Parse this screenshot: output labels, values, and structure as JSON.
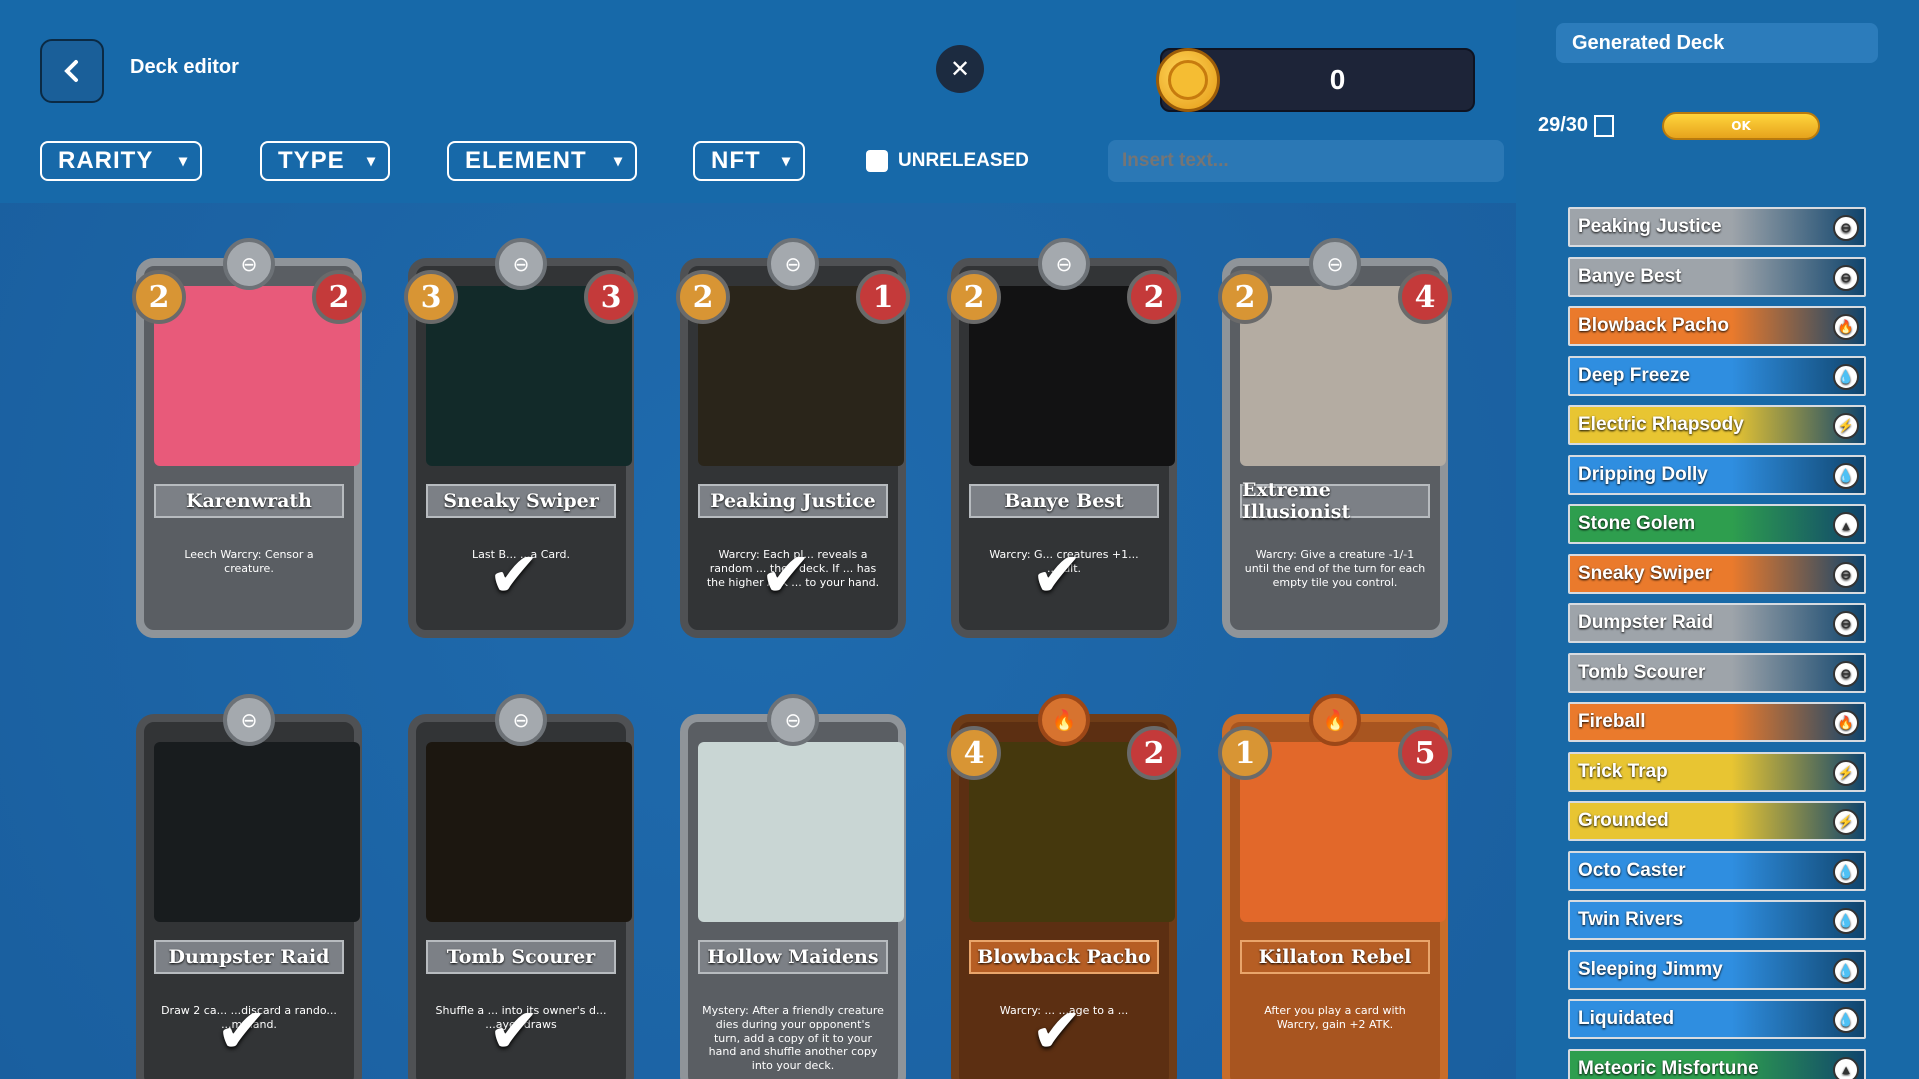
{
  "header": {
    "title": "Deck editor",
    "coins": "0",
    "close_glyph": "✕"
  },
  "filters": [
    {
      "label": "RARITY"
    },
    {
      "label": "TYPE"
    },
    {
      "label": "ELEMENT"
    },
    {
      "label": "NFT"
    }
  ],
  "unreleased_label": "UNRELEASED",
  "search": {
    "placeholder": "Insert text..."
  },
  "cards": [
    {
      "name": "Karenwrath",
      "cost": "2",
      "atk": "2",
      "desc": "Leech\nWarcry: Censor a creature.",
      "selected": false,
      "element": "neutral",
      "art": "#e85a7a"
    },
    {
      "name": "Sneaky Swiper",
      "cost": "3",
      "atk": "3",
      "desc": "Last B... ...a Card.",
      "selected": true,
      "element": "neutral",
      "art": "#3c8a88"
    },
    {
      "name": "Peaking Justice",
      "cost": "2",
      "atk": "1",
      "desc": "Warcry: Each pl... reveals a random ... their deck. If ... has the higher ATK ... to your hand.",
      "selected": true,
      "element": "neutral",
      "art": "#8a7a58"
    },
    {
      "name": "Banye Best",
      "cost": "2",
      "atk": "2",
      "desc": "Warcry: G... creatures +1... ...sult.",
      "selected": true,
      "element": "neutral",
      "art": "#3a3a3f"
    },
    {
      "name": "Extreme Illusionist",
      "cost": "2",
      "atk": "4",
      "desc": "Warcry: Give a creature -1/-1 until the end of the turn for each empty tile you control.",
      "selected": false,
      "element": "neutral",
      "art": "#b4aca2"
    },
    {
      "name": "Dumpster Raid",
      "cost": "",
      "atk": "",
      "desc": "Draw 2 ca... ...discard a rando... ...m hand.",
      "selected": true,
      "element": "neutral",
      "art": "#505a62"
    },
    {
      "name": "Tomb Scourer",
      "cost": "",
      "atk": "",
      "desc": "Shuffle a ... into its owner's d... ...ayer draws",
      "selected": true,
      "element": "neutral",
      "art": "#5a4a36"
    },
    {
      "name": "Hollow Maidens",
      "cost": "",
      "atk": "",
      "desc": "Mystery: After a friendly creature dies during your opponent's turn, add a copy of it to your hand and shuffle another copy into your deck.",
      "selected": false,
      "element": "neutral",
      "art": "#c9d6d4"
    },
    {
      "name": "Blowback Pacho",
      "cost": "4",
      "atk": "2",
      "desc": "Warcry: ... ...age to a ...",
      "selected": true,
      "element": "fire",
      "art": "#e3b72a"
    },
    {
      "name": "Killaton Rebel",
      "cost": "1",
      "atk": "5",
      "desc": "After you play a card with Warcry, gain +2 ATK.",
      "selected": false,
      "element": "fire",
      "art": "#e2682a"
    }
  ],
  "sidebar": {
    "deck_name": "Generated Deck",
    "count": "29/30",
    "ok_label": "OK",
    "deck": [
      {
        "name": "Peaking Justice",
        "color": "#9ea4aa",
        "el": "neutral-icon",
        "glyph": "⊖"
      },
      {
        "name": "Banye Best",
        "color": "#9ea4aa",
        "el": "neutral-icon",
        "glyph": "⊖"
      },
      {
        "name": "Blowback Pacho",
        "color": "#ea7a2c",
        "el": "fire-icon",
        "glyph": "🔥"
      },
      {
        "name": "Deep Freeze",
        "color": "#2f8ee0",
        "el": "water-icon",
        "glyph": "💧"
      },
      {
        "name": "Electric Rhapsody",
        "color": "#e8c532",
        "el": "lightning-icon",
        "glyph": "⚡"
      },
      {
        "name": "Dripping Dolly",
        "color": "#2f8ee0",
        "el": "water-icon",
        "glyph": "💧"
      },
      {
        "name": "Stone Golem",
        "color": "#2e9e4e",
        "el": "earth-icon",
        "glyph": "▲"
      },
      {
        "name": "Sneaky Swiper",
        "color": "#ea7a2c",
        "el": "neutral-icon",
        "glyph": "⊖"
      },
      {
        "name": "Dumpster Raid",
        "color": "#9ea4aa",
        "el": "neutral-icon",
        "glyph": "⊖"
      },
      {
        "name": "Tomb Scourer",
        "color": "#9ea4aa",
        "el": "neutral-icon",
        "glyph": "⊖"
      },
      {
        "name": "Fireball",
        "color": "#ea7a2c",
        "el": "fire-icon",
        "glyph": "🔥"
      },
      {
        "name": "Trick Trap",
        "color": "#e8c532",
        "el": "lightning-icon",
        "glyph": "⚡"
      },
      {
        "name": "Grounded",
        "color": "#e8c532",
        "el": "lightning-icon",
        "glyph": "⚡"
      },
      {
        "name": "Octo Caster",
        "color": "#2f8ee0",
        "el": "water-icon",
        "glyph": "💧"
      },
      {
        "name": "Twin Rivers",
        "color": "#2f8ee0",
        "el": "water-icon",
        "glyph": "💧"
      },
      {
        "name": "Sleeping Jimmy",
        "color": "#2f8ee0",
        "el": "water-icon",
        "glyph": "💧"
      },
      {
        "name": "Liquidated",
        "color": "#2f8ee0",
        "el": "water-icon",
        "glyph": "💧"
      },
      {
        "name": "Meteoric Misfortune",
        "color": "#2e9e4e",
        "el": "earth-icon",
        "glyph": "▲"
      }
    ]
  }
}
